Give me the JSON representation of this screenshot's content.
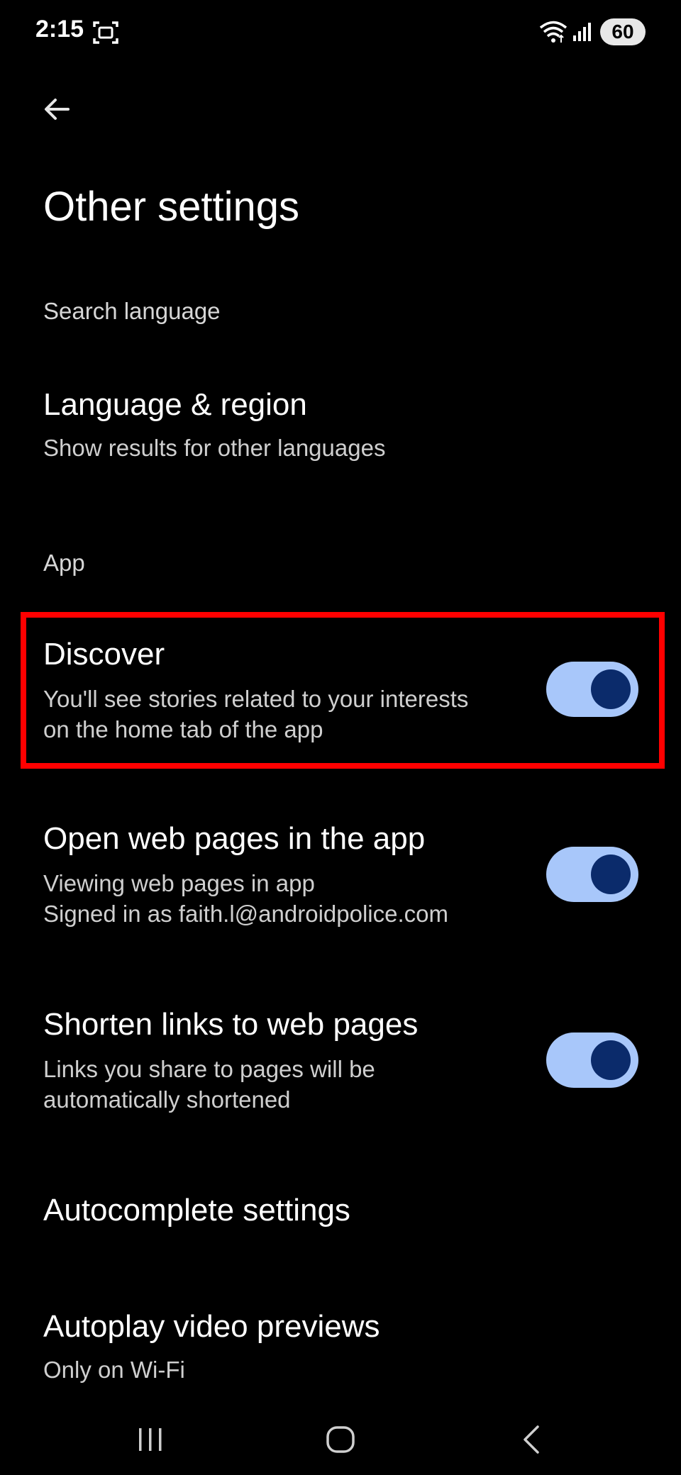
{
  "status_bar": {
    "time": "2:15",
    "battery": "60",
    "icons": [
      "screenshot-icon",
      "wifi-icon",
      "signal-icon"
    ]
  },
  "app_bar": {
    "back_icon": "arrow-back-icon",
    "title": "Other settings"
  },
  "sections": {
    "search_language": "Search language",
    "app": "App"
  },
  "settings": {
    "language_region": {
      "title": "Language & region",
      "summary": "Show results for other languages"
    },
    "discover": {
      "title": "Discover",
      "summary_line1": "You'll see stories related to your interests",
      "summary_line2": "on the home tab of the app",
      "enabled": true
    },
    "open_web_pages": {
      "title": "Open web pages in the app",
      "summary_line1": "Viewing web pages in app",
      "summary_line2": "Signed in as faith.l@androidpolice.com",
      "enabled": true
    },
    "shorten_links": {
      "title": "Shorten links to web pages",
      "summary_line1": "Links you share to pages will be",
      "summary_line2": "automatically shortened",
      "enabled": true
    },
    "autocomplete": {
      "title": "Autocomplete settings"
    },
    "autoplay": {
      "title": "Autoplay video previews",
      "summary": "Only on Wi-Fi"
    }
  },
  "colors": {
    "background": "#000000",
    "toggle_track": "#a8c7fa",
    "toggle_thumb": "#0b2b6b",
    "highlight": "#ff0000"
  },
  "nav_bar": {
    "icons": [
      "recent-apps-icon",
      "home-icon",
      "back-nav-icon"
    ]
  }
}
